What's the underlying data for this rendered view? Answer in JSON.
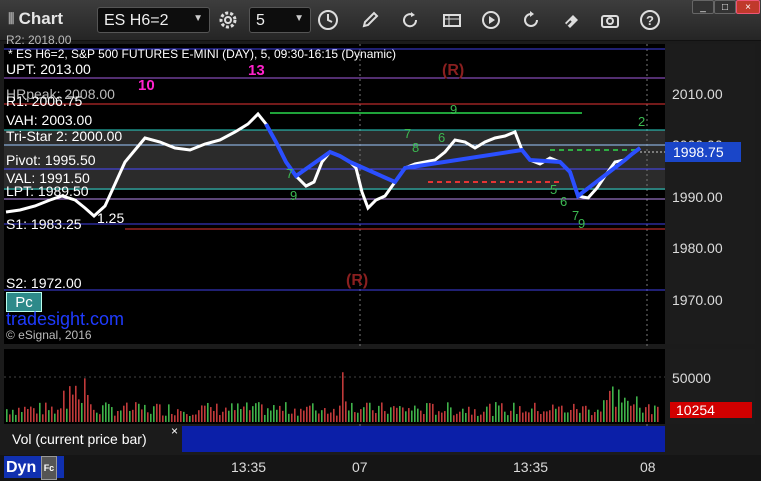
{
  "window": {
    "title": "Chart",
    "symbol": "ES H6=2",
    "interval": "5",
    "controls": {
      "minimize": "_",
      "maximize": "□",
      "close": "×"
    }
  },
  "toolbar": {
    "icons": [
      "gear-icon",
      "clock-icon",
      "pencil-icon",
      "refresh-icon",
      "data-table-icon",
      "play-icon",
      "eraser-icon",
      "camera-icon",
      "help-icon"
    ]
  },
  "chart": {
    "header": "* ES H6=2, S&P 500 FUTURES E-MINI (DAY), 5, 09:30-16:15 (Dynamic)",
    "levels": [
      {
        "label": "UPT: 2013.00"
      },
      {
        "label": "R1: 2006.75"
      },
      {
        "label": "VAH: 2003.00"
      },
      {
        "label": "Tri-Star 2: 2000.00"
      },
      {
        "label": "Pivot: 1995.50"
      },
      {
        "label": "VAL: 1991.50"
      },
      {
        "label": "LPT: 1989.50"
      },
      {
        "label": "S1: 1983.25"
      },
      {
        "label": "S2: 1972.00"
      }
    ],
    "partial_top_label": "R2: 2018.00",
    "partial_hr_label": "HRpeak: 2008.00",
    "small_label": "1.25",
    "r_markers": [
      "(R)",
      "(R)"
    ],
    "magenta_marks": [
      "10",
      "13"
    ],
    "watermark": "tradesight.com",
    "copyright": "© eSignal, 2016",
    "pc_button": "Pc",
    "price_axis": [
      "2010.00",
      "2000.00",
      "1990.00",
      "1980.00",
      "1970.00"
    ],
    "last_price": "1998.75",
    "last_price_color": "#1a46c8"
  },
  "volume": {
    "axis_label": "50000",
    "last_volume": "10254",
    "last_volume_color": "#d10000",
    "legend": "Vol (current price bar)",
    "legend_close": "×"
  },
  "time_axis": {
    "labels": [
      "13:35",
      "07",
      "13:35",
      "08"
    ],
    "dyn_label": "Dyn",
    "dyn_icon": "Fc"
  }
}
